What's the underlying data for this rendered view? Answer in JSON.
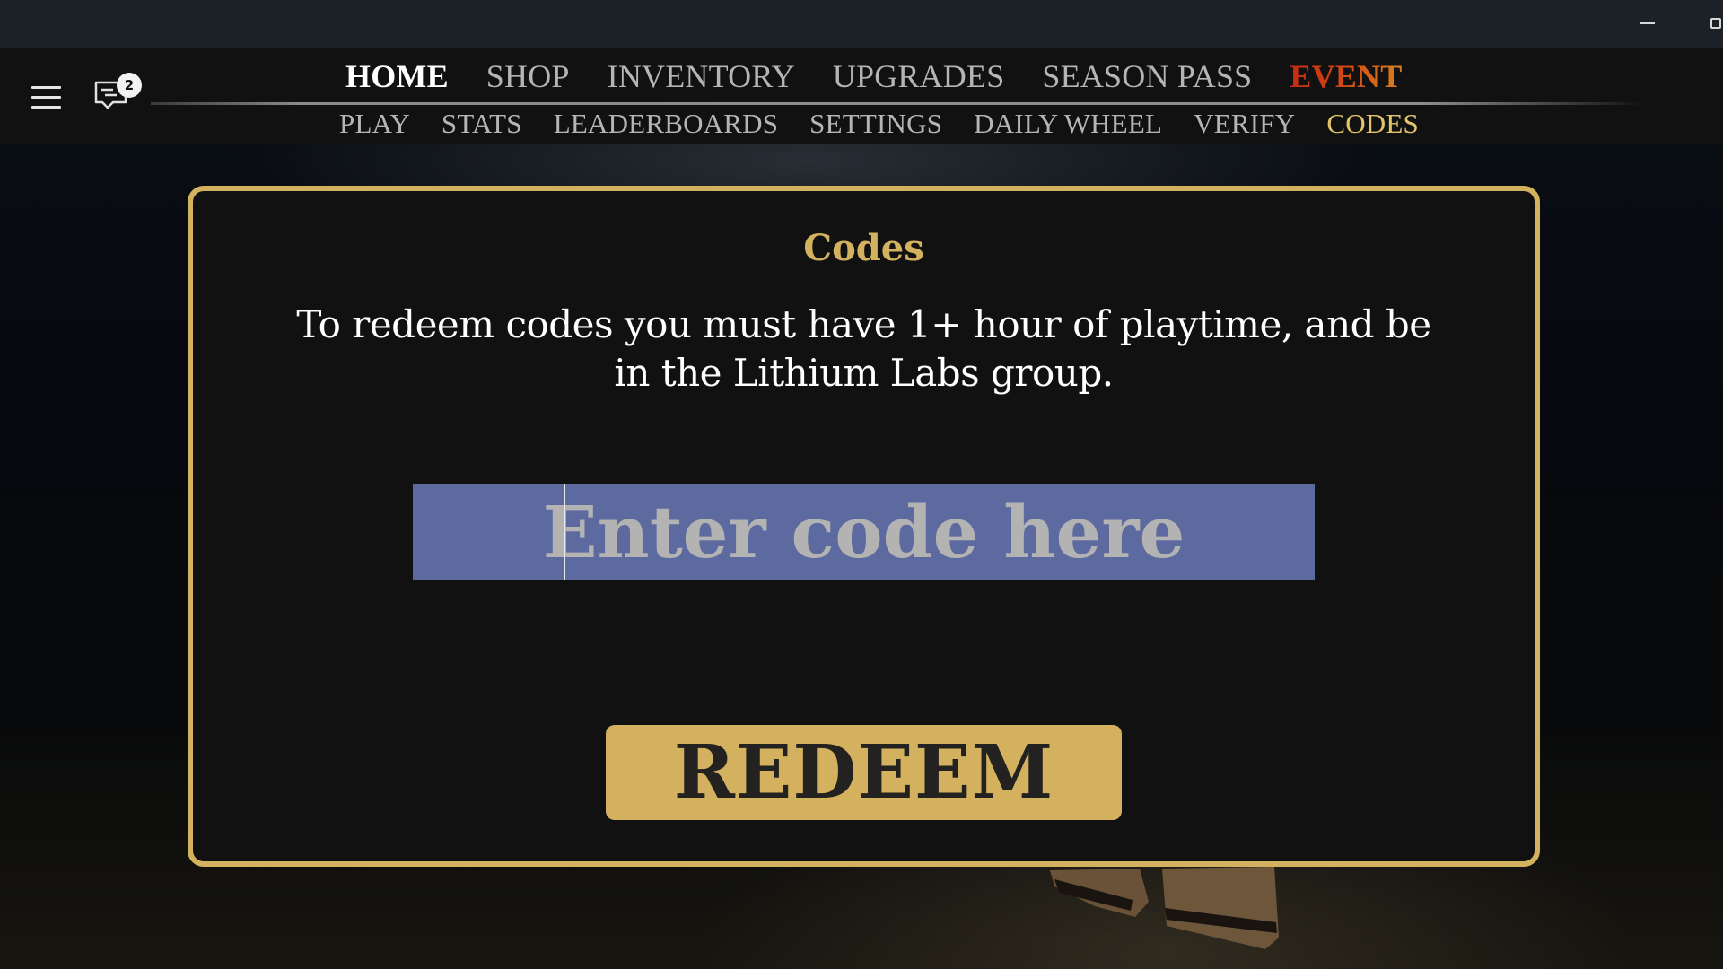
{
  "window": {
    "minimize_icon": "minimize-icon",
    "restore_icon": "restore-icon"
  },
  "header": {
    "menu_icon": "hamburger-menu-icon",
    "chat_icon": "chat-bubble-icon",
    "chat_badge_count": "2",
    "primary_nav": [
      {
        "label": "HOME",
        "state": "active"
      },
      {
        "label": "SHOP",
        "state": "normal"
      },
      {
        "label": "INVENTORY",
        "state": "normal"
      },
      {
        "label": "UPGRADES",
        "state": "normal"
      },
      {
        "label": "SEASON PASS",
        "state": "normal"
      },
      {
        "label": "EVENT",
        "state": "highlight"
      }
    ],
    "secondary_nav": [
      {
        "label": "PLAY",
        "state": "normal"
      },
      {
        "label": "STATS",
        "state": "normal"
      },
      {
        "label": "LEADERBOARDS",
        "state": "normal"
      },
      {
        "label": "SETTINGS",
        "state": "normal"
      },
      {
        "label": "DAILY WHEEL",
        "state": "normal"
      },
      {
        "label": "VERIFY",
        "state": "normal"
      },
      {
        "label": "CODES",
        "state": "active"
      }
    ]
  },
  "codes_panel": {
    "title": "Codes",
    "description": "To redeem codes you must have 1+ hour of playtime, and be in the Lithium Labs group.",
    "input": {
      "value": "",
      "placeholder": "Enter code here"
    },
    "redeem_label": "REDEEM"
  },
  "colors": {
    "accent_gold": "#d3b15e",
    "input_bg": "#5c6aa0",
    "event_red": "#c62a12",
    "event_orange": "#d8801f",
    "codes_active": "#e2c46b"
  }
}
